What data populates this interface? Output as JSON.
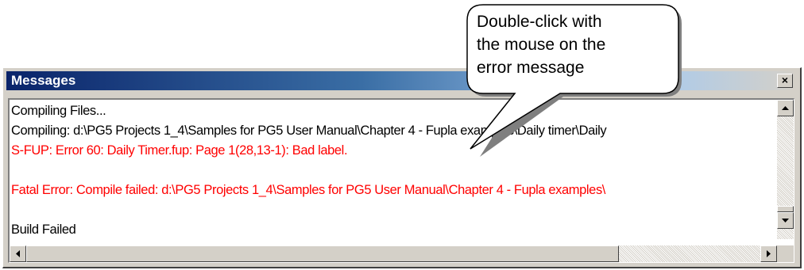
{
  "window": {
    "title": "Messages",
    "close_symbol": "×"
  },
  "log": {
    "lines": [
      {
        "text": "Compiling Files...",
        "type": "normal"
      },
      {
        "text": "Compiling: d:\\PG5 Projects 1_4\\Samples for PG5 User Manual\\Chapter 4 - Fupla examples\\Daily timer\\Daily",
        "type": "normal"
      },
      {
        "text": "S-FUP: Error 60: Daily Timer.fup: Page 1(28,13-1):  Bad label.",
        "type": "error"
      },
      {
        "text": "",
        "type": "normal"
      },
      {
        "text": "Fatal Error: Compile failed: d:\\PG5 Projects 1_4\\Samples for PG5 User Manual\\Chapter 4 - Fupla examples\\",
        "type": "error"
      },
      {
        "text": "",
        "type": "normal"
      },
      {
        "text": "Build Failed",
        "type": "normal"
      }
    ]
  },
  "callout": {
    "lines": [
      "Double-click with",
      "the mouse on the",
      "error message"
    ]
  },
  "colors": {
    "error": "#ff0000",
    "title_bar_start": "#0a246a",
    "window_face": "#d4d0c8"
  },
  "icons": {
    "scroll_up": "scroll-up-arrow-icon",
    "scroll_down": "scroll-down-arrow-icon",
    "scroll_left": "scroll-left-arrow-icon",
    "scroll_right": "scroll-right-arrow-icon",
    "close": "close-icon"
  }
}
